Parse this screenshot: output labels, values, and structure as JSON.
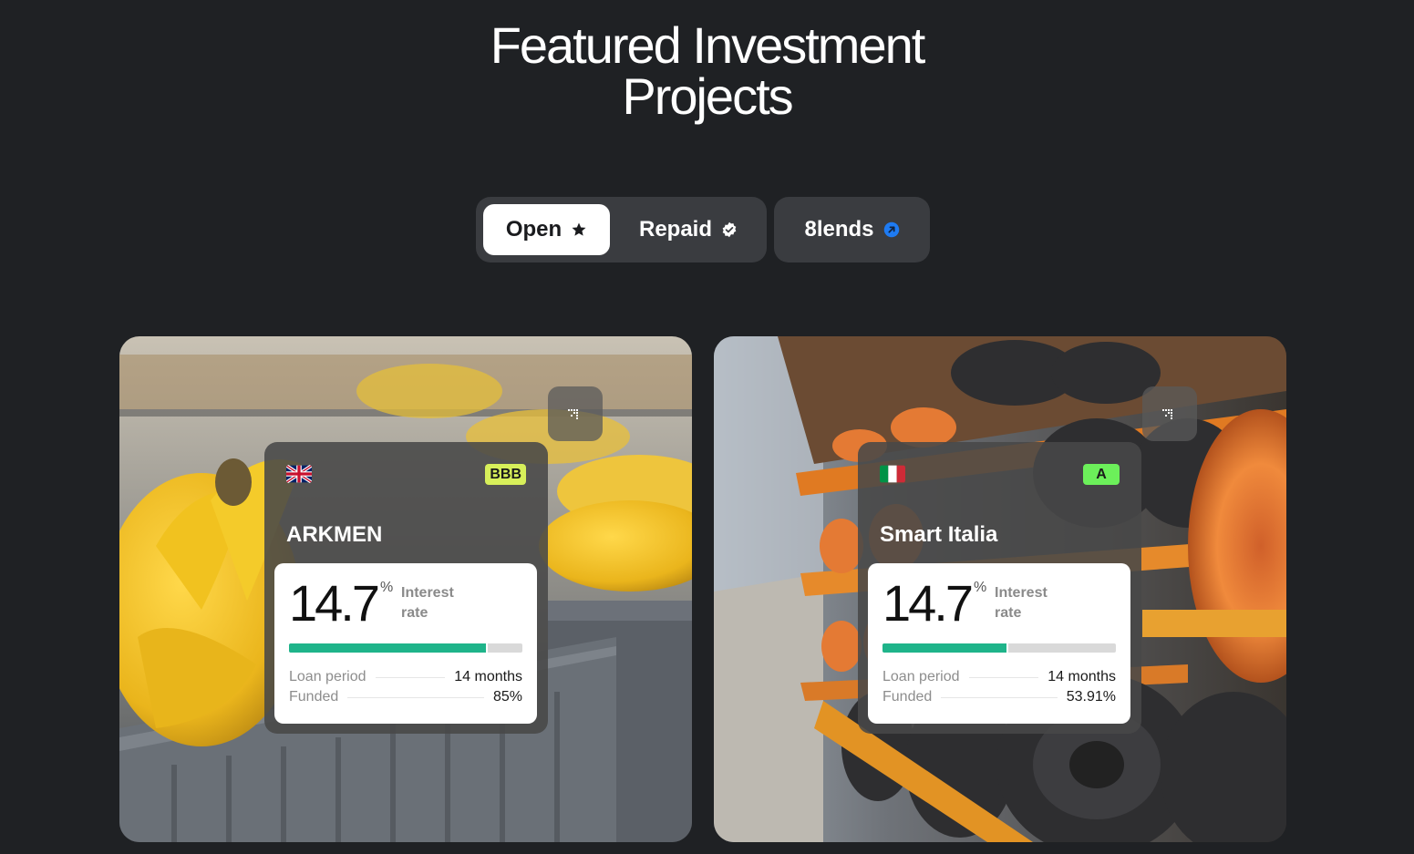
{
  "heading": {
    "line1": "Featured Investment",
    "line2": "Projects"
  },
  "tabs": {
    "open": {
      "label": "Open",
      "icon": "star-icon"
    },
    "repaid": {
      "label": "Repaid",
      "icon": "verified-check-icon"
    },
    "eightlends": {
      "label": "8lends",
      "icon": "arrow-up-right-circle-icon",
      "icon_color": "#1e7bf2"
    }
  },
  "projects": [
    {
      "name": "ARKMEN",
      "country_flag": "united-kingdom-flag-icon",
      "rating": "BBB",
      "rating_color": "#d7ef5a",
      "interest_rate": "14.7",
      "interest_unit": "%",
      "interest_label_1": "Interest",
      "interest_label_2": "rate",
      "funded_fraction": 0.85,
      "loan_period_label": "Loan period",
      "loan_period": "14 months",
      "funded_label": "Funded",
      "funded": "85%",
      "background": "bananas-in-warehouse-crates"
    },
    {
      "name": "Smart Italia",
      "country_flag": "italy-flag-icon",
      "rating": "A",
      "rating_color": "#6cf05a",
      "interest_rate": "14.7",
      "interest_unit": "%",
      "interest_label_1": "Interest",
      "interest_label_2": "rate",
      "funded_fraction": 0.5391,
      "loan_period_label": "Loan period",
      "loan_period": "14 months",
      "funded_label": "Funded",
      "funded": "53.91%",
      "background": "cable-reels-on-warehouse-shelves"
    }
  ],
  "colors": {
    "page_bg": "#1f2124",
    "progress": "#1fb48a",
    "tab_bg": "#3a3c40"
  }
}
